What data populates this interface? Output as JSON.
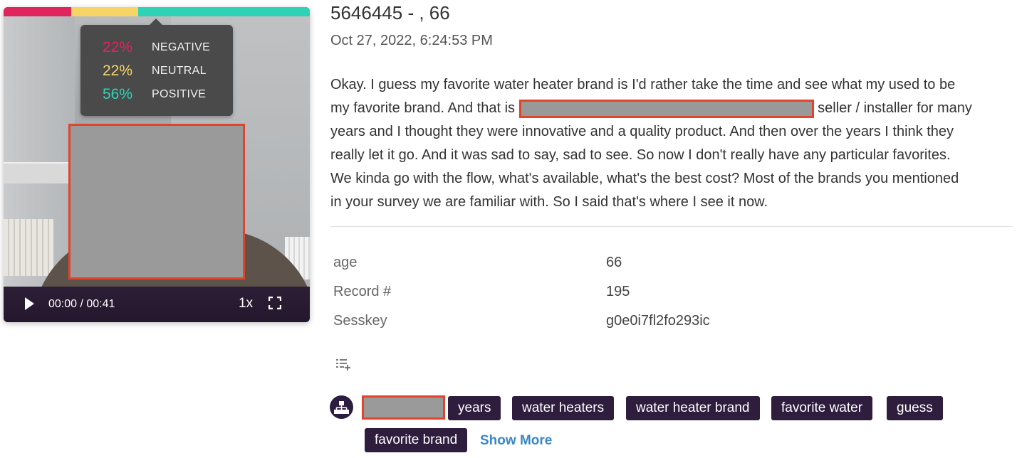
{
  "video": {
    "sentiment_bar": [
      {
        "name": "negative",
        "fraction": 0.22,
        "color": "#e0245e"
      },
      {
        "name": "neutral",
        "fraction": 0.22,
        "color": "#f7d564"
      },
      {
        "name": "positive",
        "fraction": 0.56,
        "color": "#2ed3b7"
      }
    ],
    "tooltip": {
      "negative_pct": "22%",
      "negative_label": "NEGATIVE",
      "negative_color": "#e0245e",
      "neutral_pct": "22%",
      "neutral_label": "NEUTRAL",
      "neutral_color": "#f7d564",
      "positive_pct": "56%",
      "positive_label": "POSITIVE",
      "positive_color": "#2ed3b7"
    },
    "controls": {
      "play_icon": "play-icon",
      "time": "00:00 / 00:41",
      "speed": "1x",
      "fullscreen_icon": "fullscreen-icon"
    }
  },
  "header": {
    "title": "5646445 - , 66",
    "timestamp": "Oct 27, 2022, 6:24:53 PM"
  },
  "transcript": {
    "line1": "Okay. I guess my favorite water heater brand is I'd rather take the time and see what my used to be",
    "line2_before": "my favorite brand. And that is ",
    "line2_after": " seller / installer for many",
    "line3": "years and I thought they were innovative and a quality product. And then over the years I think they",
    "line4": "really let it go. And it was sad to say, sad to see. So now I don't really have any particular favorites.",
    "line5": "We kinda go with the flow, what's available, what's the best cost? Most of the brands you mentioned",
    "line6": "in your survey we are familiar with. So I said that's where I see it now."
  },
  "metadata": [
    {
      "key": "age",
      "value": "66"
    },
    {
      "key": "Record #",
      "value": "195"
    },
    {
      "key": "Sesskey",
      "value": "g0e0i7fl2fo293ic"
    }
  ],
  "tags": {
    "icon": "hierarchy-icon",
    "add_icon": "playlist-add-icon",
    "items": [
      "years",
      "water heaters",
      "water heater brand",
      "favorite water",
      "guess",
      "favorite brand"
    ],
    "show_more": "Show More"
  }
}
